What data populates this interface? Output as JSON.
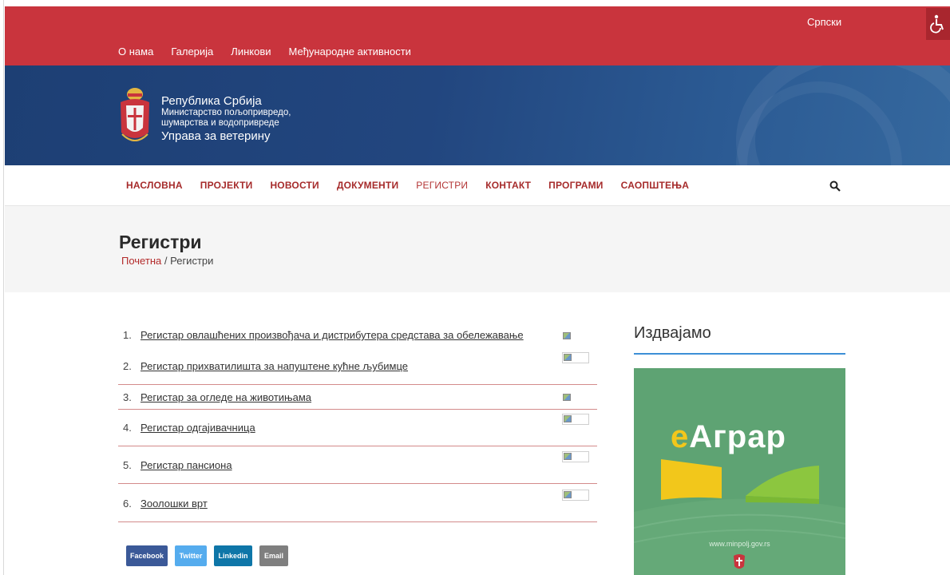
{
  "top": {
    "language": "Српски",
    "nav": [
      "О нама",
      "Галерија",
      "Линкови",
      "Међународне активности"
    ]
  },
  "brand": {
    "line1": "Република Србија",
    "line2": "Министарство пољопривредо,",
    "line3": "шумарства и водопривреде",
    "line4": "Управа за ветерину"
  },
  "main_nav": [
    "НАСЛОВНА",
    "ПРОЈЕКТИ",
    "НОВОСТИ",
    "ДОКУМЕНТИ",
    "РЕГИСТРИ",
    "КОНТАКТ",
    "ПРОГРАМИ",
    "САОПШТЕЊА"
  ],
  "page": {
    "title": "Регистри",
    "breadcrumb_home": "Почетна",
    "breadcrumb_sep": "/",
    "breadcrumb_current": "Регистри"
  },
  "registers": [
    {
      "num": "1.",
      "label": "Регистар овлашћених произвођача и дистрибутера средстава за обележавање"
    },
    {
      "num": "2.",
      "label": "Регистар прихватилишта за напуштене кућне љубимце"
    },
    {
      "num": "3.",
      "label": "Регистар за огледе на животињама"
    },
    {
      "num": "4.",
      "label": "Регистар одгајивачница"
    },
    {
      "num": "5.",
      "label": "Регистар пансиона"
    },
    {
      "num": "6.",
      "label": "Зоолошки врт"
    }
  ],
  "sidebar": {
    "title": "Издвајамо",
    "promo_logo_prefix": "е",
    "promo_logo_rest": "Аграр",
    "promo_url": "www.minpolj.gov.rs"
  },
  "share": {
    "facebook": "Facebook",
    "twitter": "Twitter",
    "linkedin": "Linkedin",
    "email": "Email"
  },
  "colors": {
    "topbar": "#c9343d",
    "banner": "#1d3f74",
    "nav_text": "#a62b2b",
    "accent_rule": "#3d8fd6",
    "promo_bg": "#5ea373",
    "facebook": "#3b5998",
    "twitter": "#55acee",
    "linkedin": "#0e76a8",
    "email": "#7f7f7f"
  },
  "icons": {
    "accessibility": "wheelchair-icon",
    "search": "search-icon",
    "crest": "serbia-coat-of-arms-icon",
    "placeholder": "broken-image-icon"
  }
}
